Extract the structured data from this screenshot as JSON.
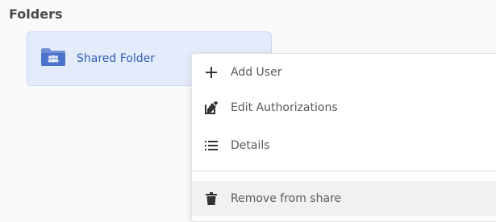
{
  "section": {
    "title": "Folders"
  },
  "folder": {
    "name": "Shared Folder",
    "icon": "shared-folder-icon",
    "card_color": "#e4ecfb",
    "accent_color": "#2f5fb8"
  },
  "context_menu": {
    "items": [
      {
        "label": "Add User",
        "icon": "plus-icon"
      },
      {
        "label": "Edit Authorizations",
        "icon": "edit-icon"
      },
      {
        "label": "Details",
        "icon": "list-icon"
      },
      {
        "label": "Remove from share",
        "icon": "trash-icon"
      }
    ]
  }
}
